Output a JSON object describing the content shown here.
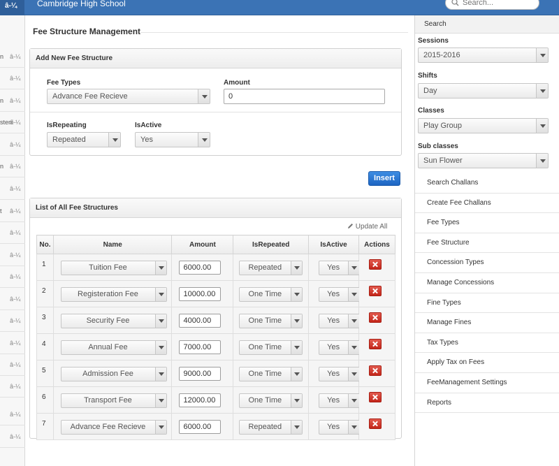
{
  "topbar": {
    "left_tab": "â-¼",
    "school_name": "Cambridge High School",
    "search_placeholder": "Search..."
  },
  "left_nav": [
    {
      "text": "n",
      "caret": "â-¼"
    },
    {
      "text": "",
      "caret": "â-¼"
    },
    {
      "text": "n",
      "caret": "â-¼"
    },
    {
      "text": "steni",
      "caret": "â-¼"
    },
    {
      "text": "",
      "caret": "â-¼"
    },
    {
      "text": "n",
      "caret": "â-¼"
    },
    {
      "text": "",
      "caret": "â-¼"
    },
    {
      "text": "t",
      "caret": "â-¼"
    },
    {
      "text": "",
      "caret": "â-¼"
    },
    {
      "text": "",
      "caret": "â-¼"
    },
    {
      "text": "",
      "caret": "â-¼"
    },
    {
      "text": "",
      "caret": "â-¼"
    },
    {
      "text": "",
      "caret": "â-¼"
    },
    {
      "text": "",
      "caret": "â-¼"
    },
    {
      "text": "",
      "caret": "â-¼"
    },
    {
      "text": "",
      "caret": "â-¼"
    },
    {
      "text": "",
      "caret": "â-¼"
    },
    {
      "text": "",
      "caret": "â-¼"
    }
  ],
  "page_title": "Fee Structure Management",
  "add_panel": {
    "title": "Add New Fee Structure",
    "fee_types_label": "Fee Types",
    "fee_types_value": "Advance Fee Recieve",
    "amount_label": "Amount",
    "amount_value": "0",
    "isrepeating_label": "IsRepeating",
    "isrepeating_value": "Repeated",
    "isactive_label": "IsActive",
    "isactive_value": "Yes"
  },
  "insert_label": "Insert",
  "list_panel": {
    "title": "List of All Fee Structures",
    "update_all": "Update All",
    "headers": [
      "No.",
      "Name",
      "Amount",
      "IsRepeated",
      "IsActive",
      "Actions"
    ],
    "rows": [
      {
        "no": "1",
        "name": "Tuition Fee",
        "amount": "6000.00",
        "repeated": "Repeated",
        "active": "Yes"
      },
      {
        "no": "2",
        "name": "Registeration Fee",
        "amount": "10000.00",
        "repeated": "One Time",
        "active": "Yes"
      },
      {
        "no": "3",
        "name": "Security Fee",
        "amount": "4000.00",
        "repeated": "One Time",
        "active": "Yes"
      },
      {
        "no": "4",
        "name": "Annual Fee",
        "amount": "7000.00",
        "repeated": "One Time",
        "active": "Yes"
      },
      {
        "no": "5",
        "name": "Admission Fee",
        "amount": "9000.00",
        "repeated": "One Time",
        "active": "Yes"
      },
      {
        "no": "6",
        "name": "Transport Fee",
        "amount": "12000.00",
        "repeated": "One Time",
        "active": "Yes"
      },
      {
        "no": "7",
        "name": "Advance Fee Recieve",
        "amount": "6000.00",
        "repeated": "Repeated",
        "active": "Yes"
      }
    ]
  },
  "right_panel": {
    "search_label": "Search",
    "sessions_label": "Sessions",
    "sessions_value": "2015-2016",
    "shifts_label": "Shifts",
    "shifts_value": "Day",
    "classes_label": "Classes",
    "classes_value": "Play Group",
    "subclasses_label": "Sub classes",
    "subclasses_value": "Sun Flower",
    "menu": [
      "Search Challans",
      "Create Fee Challans",
      "Fee Types",
      "Fee Structure",
      "Concession Types",
      "Manage Concessions",
      "Fine Types",
      "Manage Fines",
      "Tax Types",
      "Apply Tax on Fees",
      "FeeManagement Settings",
      "Reports"
    ]
  },
  "colors": {
    "topbar": "#3b73b5",
    "insert_button": "#2a78d6",
    "delete_button": "#d23a2e"
  }
}
